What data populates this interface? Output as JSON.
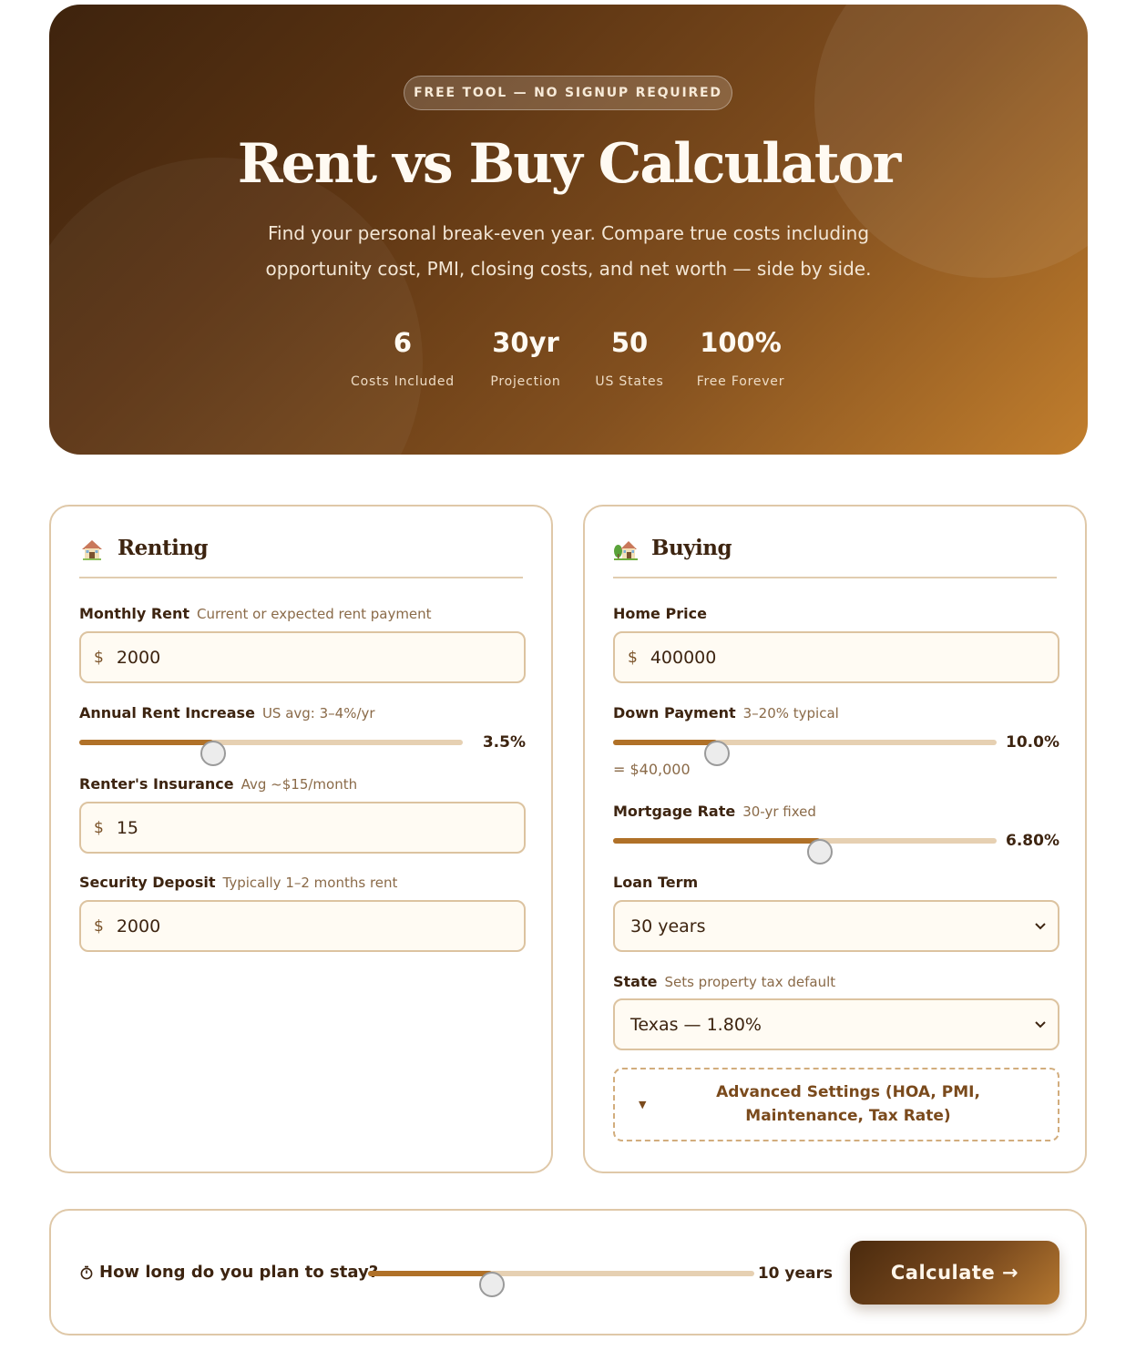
{
  "hero": {
    "badge": "FREE TOOL — NO SIGNUP REQUIRED",
    "title": "Rent vs Buy Calculator",
    "subtitle": "Find your personal break-even year. Compare true costs including opportunity cost, PMI, closing costs, and net worth — side by side.",
    "stats": [
      {
        "value": "6",
        "label": "Costs Included"
      },
      {
        "value": "30yr",
        "label": "Projection"
      },
      {
        "value": "50",
        "label": "US States"
      },
      {
        "value": "100%",
        "label": "Free Forever"
      }
    ]
  },
  "renting": {
    "icon": "house-icon",
    "title": "Renting",
    "monthly_rent": {
      "label": "Monthly Rent",
      "hint": "Current or expected rent payment",
      "prefix": "$",
      "value": "2000"
    },
    "rent_increase": {
      "label": "Annual Rent Increase",
      "hint": "US avg: 3–4%/yr",
      "value_text": "3.5%",
      "fraction": 0.35
    },
    "insurance": {
      "label": "Renter's Insurance",
      "hint": "Avg ~$15/month",
      "prefix": "$",
      "value": "15"
    },
    "deposit": {
      "label": "Security Deposit",
      "hint": "Typically 1–2 months rent",
      "prefix": "$",
      "value": "2000"
    }
  },
  "buying": {
    "icon": "house-with-garden-icon",
    "title": "Buying",
    "home_price": {
      "label": "Home Price",
      "prefix": "$",
      "value": "400000"
    },
    "down_payment": {
      "label": "Down Payment",
      "hint": "3–20% typical",
      "value_text": "10.0%",
      "fraction": 0.27,
      "equivalent": "= $40,000"
    },
    "mortgage_rate": {
      "label": "Mortgage Rate",
      "hint": "30-yr fixed",
      "value_text": "6.80%",
      "fraction": 0.54
    },
    "loan_term": {
      "label": "Loan Term",
      "selected": "30 years"
    },
    "state": {
      "label": "State",
      "hint": "Sets property tax default",
      "selected": "Texas — 1.80%"
    },
    "advanced": "Advanced Settings (HOA, PMI, Maintenance, Tax Rate)"
  },
  "stay": {
    "icon": "stopwatch-icon",
    "label": "How long do you plan to stay?",
    "value_text": "10 years",
    "fraction": 0.32,
    "button": "Calculate →"
  },
  "colors": {
    "accent": "#b07128",
    "border": "#dfc8a8",
    "text": "#3d2410"
  }
}
